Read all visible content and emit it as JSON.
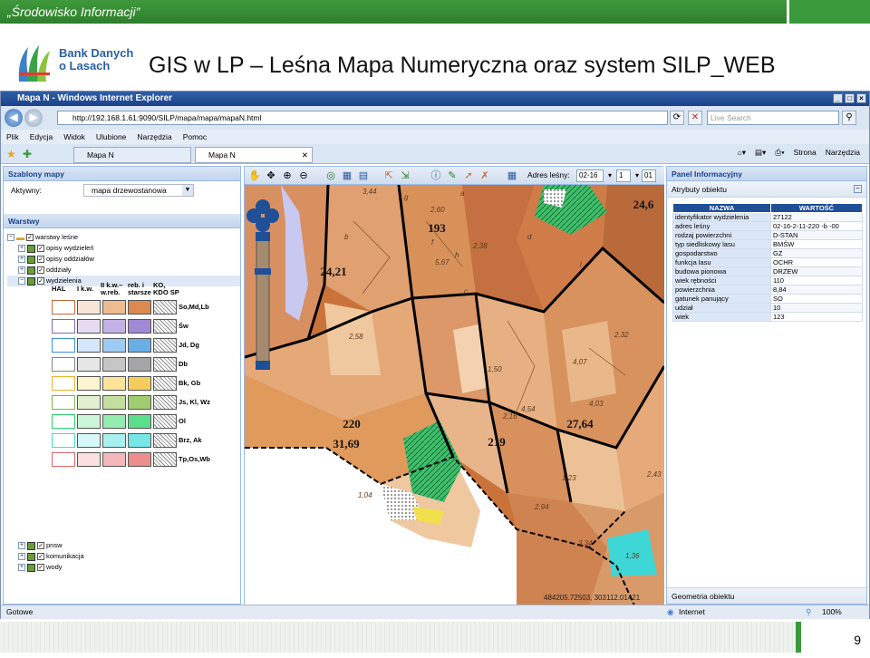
{
  "slide": {
    "top_label": "„Środowisko Informacji”",
    "title": "GIS w LP – Leśna Mapa Numeryczna oraz system  SILP_WEB",
    "logo_line1": "Bank Danych",
    "logo_line2": "o Lasach",
    "page_number": "9"
  },
  "browser": {
    "window_title": "Mapa N - Windows Internet Explorer",
    "url": "http://192.168.1.61:9090/SILP/mapa/mapa/mapaN.html",
    "search_placeholder": "Live Search",
    "menu": [
      "Plik",
      "Edycja",
      "Widok",
      "Ulubione",
      "Narzędzia",
      "Pomoc"
    ],
    "tabs": [
      "Mapa N",
      "Mapa N"
    ],
    "tools": [
      "Strona",
      "Narzędzia"
    ],
    "status_left": "Gotowe",
    "status_zone": "Internet",
    "zoom": "100%"
  },
  "left_panel": {
    "templates_header": "Szablony mapy",
    "active_label": "Aktywny:",
    "active_value": "mapa drzewostanowa",
    "layers_header": "Warstwy",
    "layers": [
      "warstwy leśne",
      "opisy wydzieleń",
      "opisy oddziałów",
      "oddziały",
      "wydzielenia"
    ],
    "bottom_layers": [
      "pnsw",
      "komunikacja",
      "wody"
    ],
    "legend_headers": [
      "HAL",
      "I k.w.",
      "II k.w.– w.reb.",
      "reb. i starsze",
      "KO, KDO SP"
    ],
    "legend_species": [
      "So,Md,Lb",
      "Św",
      "Jd, Dg",
      "Db",
      "Bk, Gb",
      "Js, Kl, Wz",
      "Ol",
      "Brz, Ak",
      "Tp,Os,Wb"
    ],
    "legend_colors": [
      [
        "#f6e6d8",
        "#eebc8e",
        "#dc8a52",
        "#c8683a"
      ],
      [
        "#e6dcf2",
        "#c3b2e6",
        "#a18ad4",
        "#8068c0"
      ],
      [
        "#d3e8fb",
        "#9cccf4",
        "#6aaee8",
        "#3d8fd8"
      ],
      [
        "#e6e6e6",
        "#c6c6c6",
        "#a6a6a6",
        "#868686"
      ],
      [
        "#fdf4d0",
        "#fbe49a",
        "#f6cd5c",
        "#eeb22e"
      ],
      [
        "#e3f0cf",
        "#c3df9e",
        "#a0cb70",
        "#7eb54a"
      ],
      [
        "#ccf6d6",
        "#94ecb0",
        "#5cdf8a",
        "#2ed06a"
      ],
      [
        "#d6f8f8",
        "#a8f0f0",
        "#76e6e6",
        "#44d8d8"
      ],
      [
        "#fbe0e0",
        "#f4b8b8",
        "#ec8e8e",
        "#e06666"
      ]
    ]
  },
  "map": {
    "toolbar_label": "Adres leśny:",
    "addr_parts": [
      "02-16",
      "1",
      "01"
    ],
    "numbers": [
      "193",
      "24,21",
      "220",
      "31,69",
      "219",
      "27,64",
      "24,6"
    ],
    "minor_labels": [
      "a",
      "g",
      "f",
      "h",
      "c",
      "b",
      "d",
      "i",
      "3,44",
      "2,60",
      "5,67",
      "2,38",
      "2,58",
      "1,50",
      "2,16",
      "4,54",
      "4,03",
      "2,32",
      "4,07",
      "2,94",
      "3,34",
      "1,04",
      "1,23",
      "2,43",
      "1,36"
    ],
    "coords": "484205.72503, 303112.01421"
  },
  "right_panel": {
    "header": "Panel Informacyjny",
    "sub_header": "Atrybuty obiektu",
    "col_name": "NAZWA",
    "col_value": "WARTOŚĆ",
    "attributes": [
      [
        "identyfikator wydzielenia",
        "27122"
      ],
      [
        "adres leśny",
        "02-16-2-11-220 -b -00"
      ],
      [
        "rodzaj powierzchni",
        "D-STAN"
      ],
      [
        "typ siedliskowy lasu",
        "BMŚW"
      ],
      [
        "gospodarstwo",
        "GZ"
      ],
      [
        "funkcja lasu",
        "OCHR"
      ],
      [
        "budowa pionowa",
        "DRZEW"
      ],
      [
        "wiek rębności",
        "110"
      ],
      [
        "powierzchnia",
        "8,84"
      ],
      [
        "gatunek panujący",
        "SO"
      ],
      [
        "udział",
        "10"
      ],
      [
        "wiek",
        "123"
      ]
    ],
    "geometry_header": "Geometria obiektu"
  },
  "colors": {
    "green": "#3a993a",
    "ie_blue": "#1c428a",
    "panel_border": "#99bbe8",
    "table_header": "#1e4f97"
  }
}
